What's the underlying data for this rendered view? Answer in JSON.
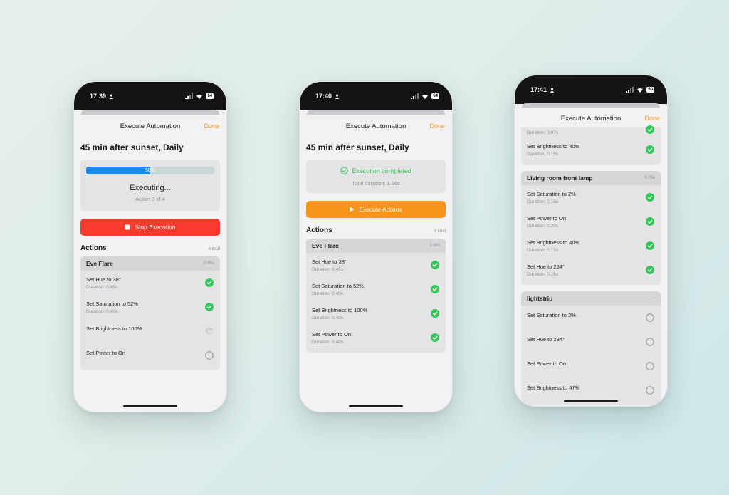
{
  "colors": {
    "accent": "#f7931e",
    "progress": "#1d8cf8",
    "stop": "#f93a2f",
    "success": "#34c759",
    "pending": "#8e8e93"
  },
  "phone1": {
    "time": "17:39",
    "battery": "64",
    "nav_title": "Execute Automation",
    "done_label": "Done",
    "title": "45 min after sunset, Daily",
    "progress": {
      "percent_label": "50%",
      "fraction": 0.5,
      "status": "Executing...",
      "sub": "Action 3 of 4"
    },
    "stop_label": "Stop Execution",
    "actions_title": "Actions",
    "actions_total": "4 total",
    "group": {
      "name": "Eve Flare",
      "duration": "0.85s",
      "rows": [
        {
          "label": "Set Hue to 38°",
          "duration": "Duration: 0.45s",
          "status": "done"
        },
        {
          "label": "Set Saturation to 52%",
          "duration": "Duration: 0.40s",
          "status": "done"
        },
        {
          "label": "Set Brightness to 100%",
          "duration": "",
          "status": "loading"
        },
        {
          "label": "Set Power to On",
          "duration": "",
          "status": "pending"
        }
      ]
    }
  },
  "phone2": {
    "time": "17:40",
    "battery": "64",
    "nav_title": "Execute Automation",
    "done_label": "Done",
    "title": "45 min after sunset, Daily",
    "completed_label": "Execution completed",
    "total_duration": "Total duration: 1.66s",
    "execute_label": "Execute Actions",
    "actions_title": "Actions",
    "actions_total": "4 total",
    "group": {
      "name": "Eve Flare",
      "duration": "1.66s",
      "rows": [
        {
          "label": "Set Hue to 38°",
          "duration": "Duration: 0.45s",
          "status": "done"
        },
        {
          "label": "Set Saturation to 52%",
          "duration": "Duration: 0.40s",
          "status": "done"
        },
        {
          "label": "Set Brightness to 100%",
          "duration": "Duration: 0.40s",
          "status": "done"
        },
        {
          "label": "Set Power to On",
          "duration": "Duration: 0.40s",
          "status": "done"
        }
      ]
    }
  },
  "phone3": {
    "time": "17:41",
    "battery": "60",
    "nav_title": "Execute Automation",
    "done_label": "Done",
    "partial_duration": "Duration: 0.07s",
    "top_row": {
      "label": "Set Brightness to 40%",
      "duration": "Duration: 0.15s",
      "status": "done"
    },
    "group_lamp": {
      "name": "Living room front lamp",
      "duration": "0.78s",
      "rows": [
        {
          "label": "Set Saturation to 2%",
          "duration": "Duration: 0.15s",
          "status": "done"
        },
        {
          "label": "Set Power to On",
          "duration": "Duration: 0.20s",
          "status": "done"
        },
        {
          "label": "Set Brightness to 40%",
          "duration": "Duration: 0.15s",
          "status": "done"
        },
        {
          "label": "Set Hue to 234°",
          "duration": "Duration: 0.28s",
          "status": "done"
        }
      ]
    },
    "group_strip": {
      "name": "lightstrip",
      "duration": "--",
      "rows": [
        {
          "label": "Set Saturation to 2%",
          "duration": "",
          "status": "pending"
        },
        {
          "label": "Set Hue to 234°",
          "duration": "",
          "status": "pending"
        },
        {
          "label": "Set Power to On",
          "duration": "",
          "status": "pending"
        },
        {
          "label": "Set Brightness to 47%",
          "duration": "",
          "status": "pending"
        }
      ]
    }
  }
}
